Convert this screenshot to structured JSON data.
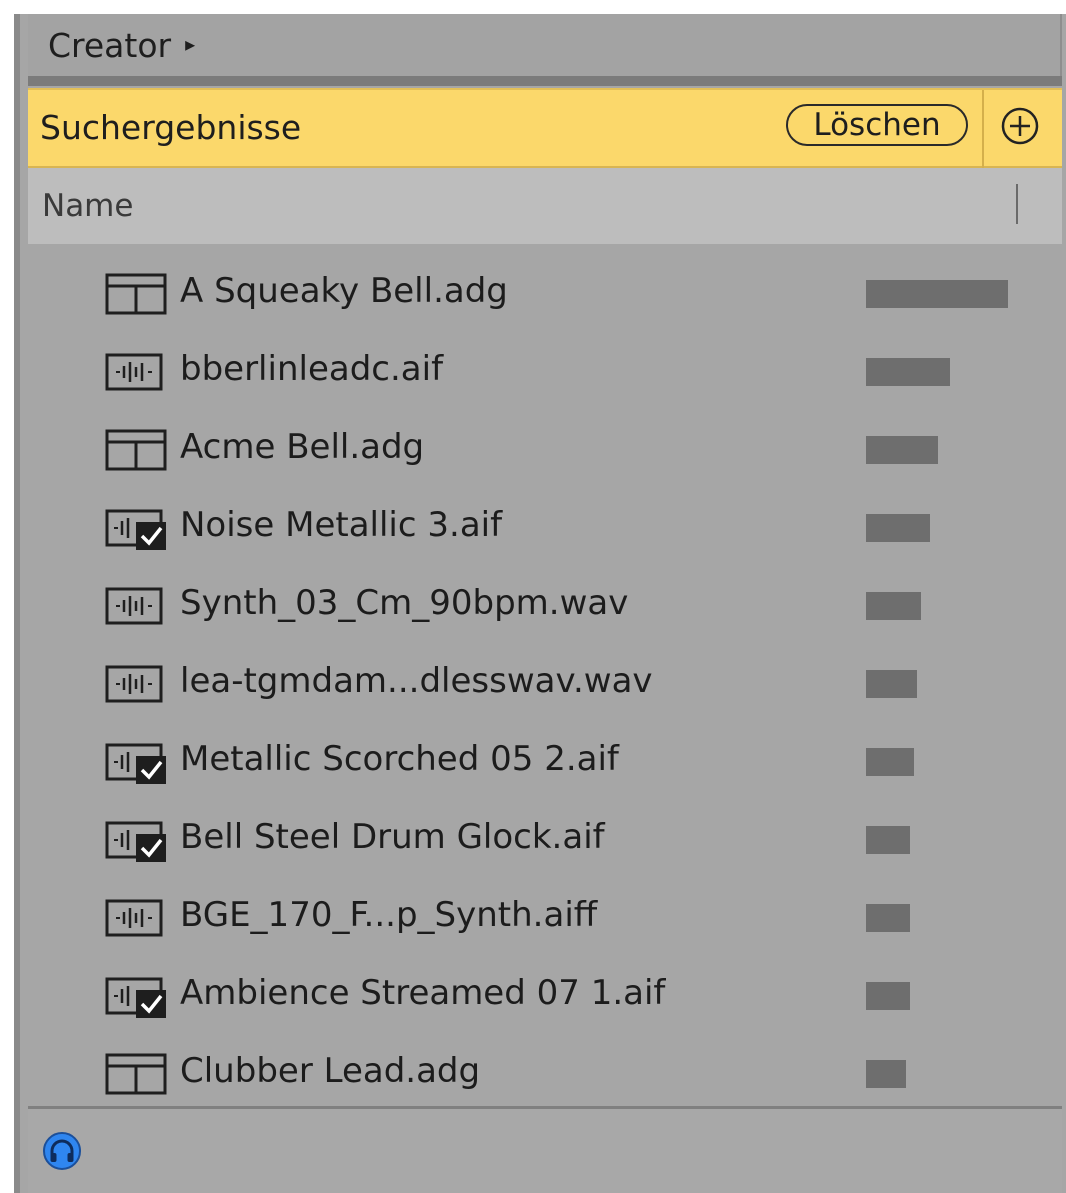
{
  "creator": {
    "label": "Creator",
    "arrow": "▸"
  },
  "results": {
    "title": "Suchergebnisse",
    "clear_label": "Löschen",
    "add_icon": "plus-circle-icon",
    "accent_color": "#fbd86b"
  },
  "table": {
    "name_header": "Name"
  },
  "items": [
    {
      "label": "A Squeaky Bell.adg",
      "type": "rack",
      "relevance": 1.0
    },
    {
      "label": "bberlinleadc.aif",
      "type": "sample",
      "relevance": 0.59
    },
    {
      "label": "Acme Bell.adg",
      "type": "rack",
      "relevance": 0.51
    },
    {
      "label": "Noise Metallic 3.aif",
      "type": "sample-checked",
      "relevance": 0.45
    },
    {
      "label": "Synth_03_Cm_90bpm.wav",
      "type": "sample",
      "relevance": 0.39
    },
    {
      "label": "lea-tgmdam...dlesswav.wav",
      "type": "sample",
      "relevance": 0.36
    },
    {
      "label": "Metallic Scorched 05 2.aif",
      "type": "sample-checked",
      "relevance": 0.34
    },
    {
      "label": "Bell Steel Drum Glock.aif",
      "type": "sample-checked",
      "relevance": 0.31
    },
    {
      "label": "BGE_170_F...p_Synth.aiff",
      "type": "sample",
      "relevance": 0.31
    },
    {
      "label": "Ambience Streamed 07 1.aif",
      "type": "sample-checked",
      "relevance": 0.31
    },
    {
      "label": "Clubber Lead.adg",
      "type": "rack",
      "relevance": 0.28
    }
  ],
  "footer": {
    "preview_icon": "headphones-icon",
    "preview_color": "#2f86f0"
  }
}
